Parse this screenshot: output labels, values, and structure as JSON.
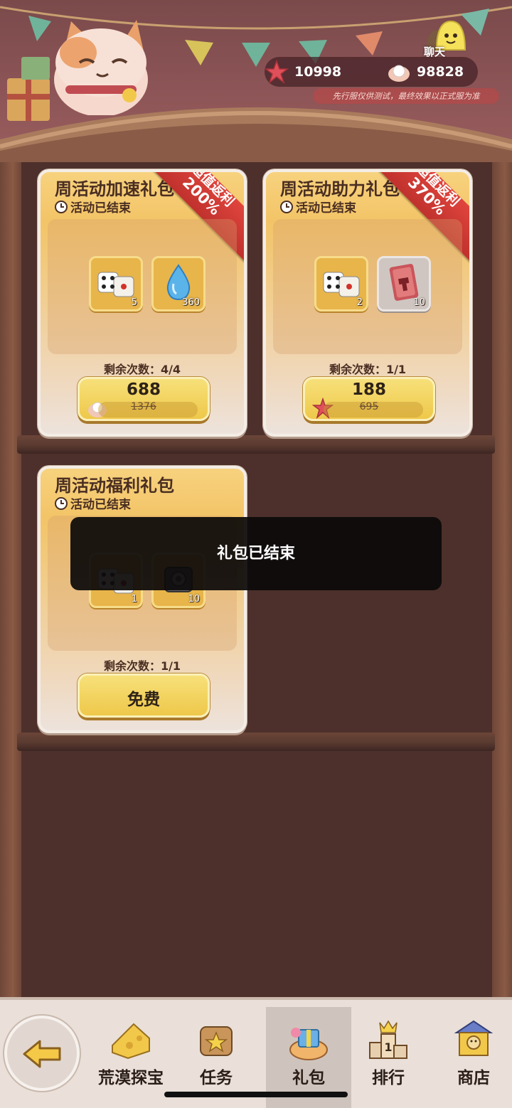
{
  "header": {
    "chat_label": "聊天",
    "star_currency": "10998",
    "pearl_currency": "98828",
    "notice": "先行服仅供测试，最终效果以正式服为准"
  },
  "cards": [
    {
      "title": "周活动加速礼包",
      "status": "活动已结束",
      "ribbon_line1": "超值返利",
      "ribbon_line2": "200%",
      "items": [
        {
          "icon": "dice-icon",
          "qty": "5"
        },
        {
          "icon": "water-drop-icon",
          "qty": "360"
        }
      ],
      "remaining": "剩余次数：4/4",
      "price": "688",
      "old_price": "1376",
      "currency_icon": "pearl-icon"
    },
    {
      "title": "周活动助力礼包",
      "status": "活动已结束",
      "ribbon_line1": "超值返利",
      "ribbon_line2": "370%",
      "items": [
        {
          "icon": "dice-icon",
          "qty": "2"
        },
        {
          "icon": "ticket-card-icon",
          "qty": "10"
        }
      ],
      "remaining": "剩余次数：1/1",
      "price": "188",
      "old_price": "695",
      "currency_icon": "starfish-icon"
    },
    {
      "title": "周活动福利礼包",
      "status": "活动已结束",
      "items": [
        {
          "icon": "dice-icon",
          "qty": "1"
        },
        {
          "icon": "chest-token-icon",
          "qty": "10"
        }
      ],
      "remaining": "剩余次数：1/1",
      "button_label": "免费"
    }
  ],
  "toast": "礼包已结束",
  "nav": {
    "items": [
      {
        "label": "荒漠探宝",
        "icon": "cheese-map-icon"
      },
      {
        "label": "任务",
        "icon": "task-scroll-icon"
      },
      {
        "label": "礼包",
        "icon": "gift-basket-icon",
        "active": true
      },
      {
        "label": "排行",
        "icon": "podium-icon"
      },
      {
        "label": "商店",
        "icon": "shop-icon"
      }
    ]
  },
  "colors": {
    "accent_gold": "#eec84a",
    "ribbon_red": "#c0312d",
    "shelf_brown": "#4d302b"
  }
}
